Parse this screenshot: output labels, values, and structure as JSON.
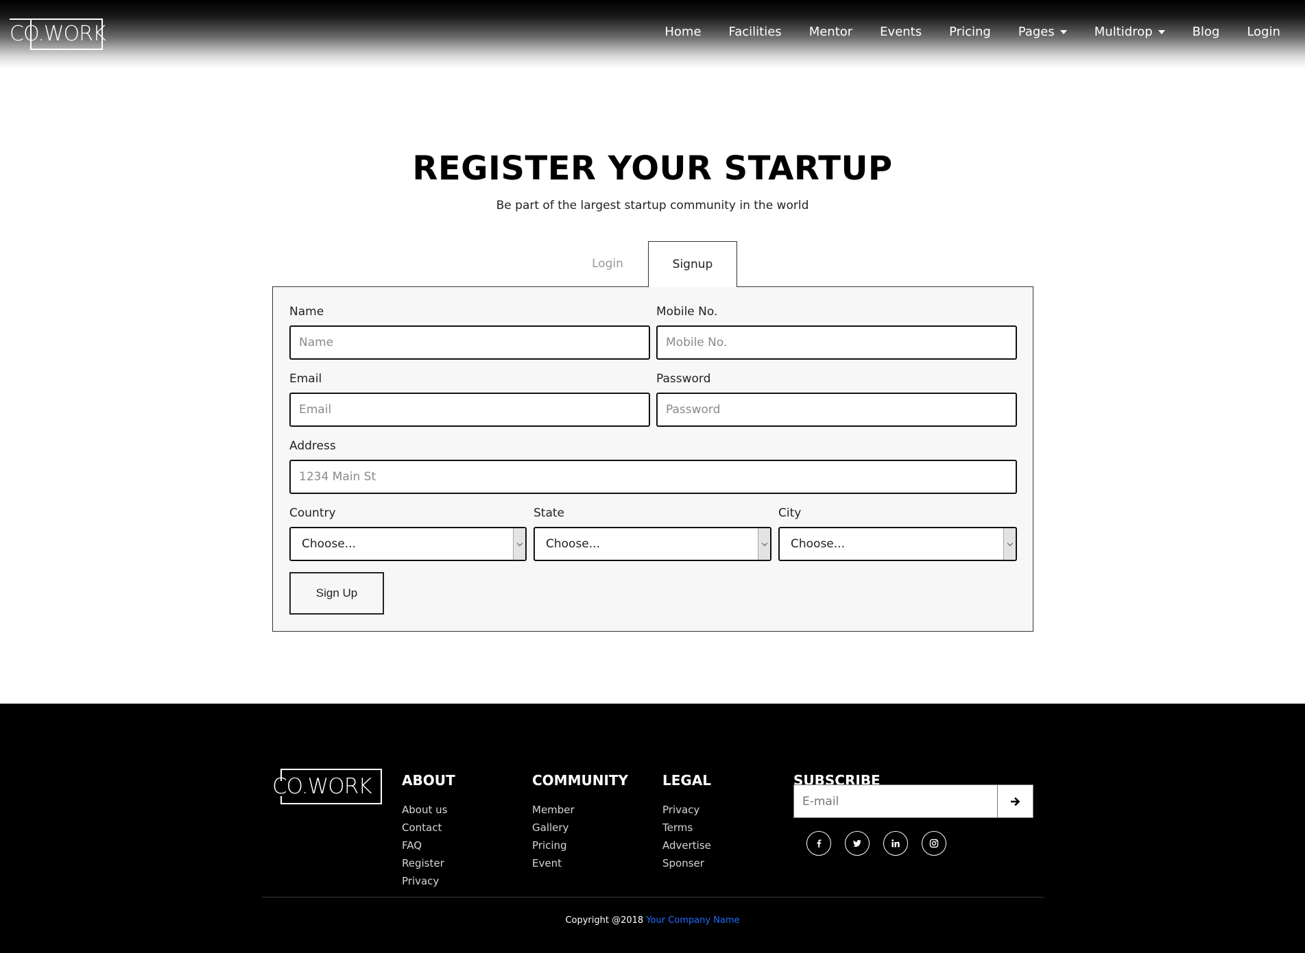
{
  "brand": {
    "logo_text": "CO.WORK"
  },
  "nav": {
    "items": [
      {
        "label": "Home",
        "dropdown": false
      },
      {
        "label": "Facilities",
        "dropdown": false
      },
      {
        "label": "Mentor",
        "dropdown": false
      },
      {
        "label": "Events",
        "dropdown": false
      },
      {
        "label": "Pricing",
        "dropdown": false
      },
      {
        "label": "Pages",
        "dropdown": true
      },
      {
        "label": "Multidrop",
        "dropdown": true
      },
      {
        "label": "Blog",
        "dropdown": false
      },
      {
        "label": "Login",
        "dropdown": false
      }
    ]
  },
  "hero": {
    "title": "REGISTER YOUR STARTUP",
    "subtitle": "Be part of the largest startup community in the world"
  },
  "tabs": {
    "login": "Login",
    "signup": "Signup",
    "active": "Signup"
  },
  "form": {
    "name": {
      "label": "Name",
      "placeholder": "Name"
    },
    "mobile": {
      "label": "Mobile No.",
      "placeholder": "Mobile No."
    },
    "email": {
      "label": "Email",
      "placeholder": "Email"
    },
    "password": {
      "label": "Password",
      "placeholder": "Password"
    },
    "address": {
      "label": "Address",
      "placeholder": "1234 Main St"
    },
    "country": {
      "label": "Country",
      "value": "Choose..."
    },
    "state": {
      "label": "State",
      "value": "Choose..."
    },
    "city": {
      "label": "City",
      "value": "Choose..."
    },
    "submit_label": "Sign Up"
  },
  "footer": {
    "logo_text": "CO.WORK",
    "about": {
      "heading": "ABOUT",
      "links": [
        "About us",
        "Contact",
        "FAQ",
        "Register",
        "Privacy"
      ]
    },
    "community": {
      "heading": "COMMUNITY",
      "links": [
        "Member",
        "Gallery",
        "Pricing",
        "Event"
      ]
    },
    "legal": {
      "heading": "LEGAL",
      "links": [
        "Privacy",
        "Terms",
        "Advertise",
        "Sponser"
      ]
    },
    "subscribe": {
      "heading": "SUBSCRIBE",
      "placeholder": "E-mail"
    },
    "social": [
      "facebook-icon",
      "twitter-icon",
      "linkedin-icon",
      "instagram-icon"
    ],
    "copyright_prefix": "Copyright @2018",
    "company_name": "Your Company Name"
  },
  "colors": {
    "accent_link": "#1e6cff",
    "footer_bg": "#000000",
    "form_bg": "#f7f7f7"
  }
}
